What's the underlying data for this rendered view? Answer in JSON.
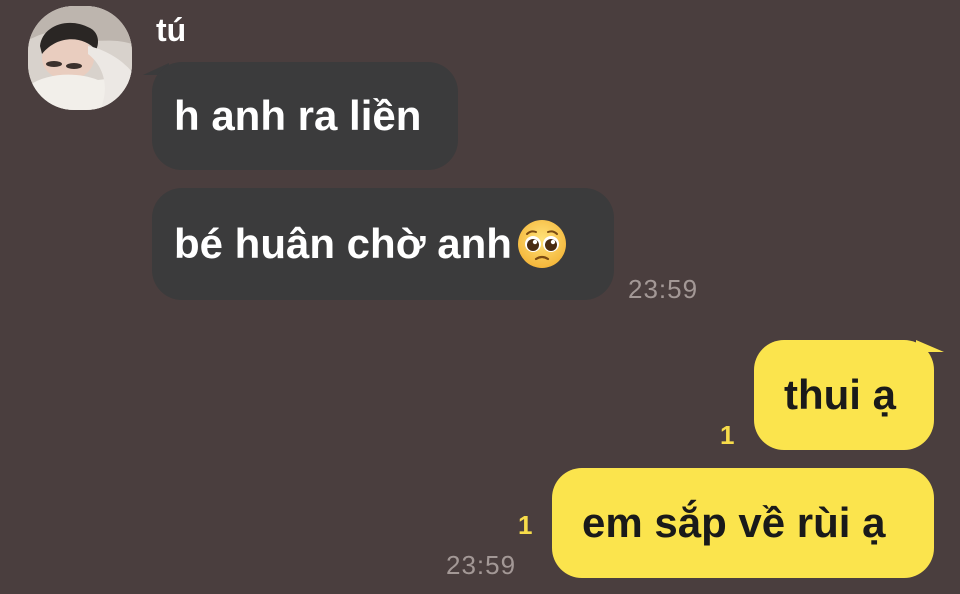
{
  "sender": {
    "name": "tú",
    "avatar_icon": "profile-photo-icon"
  },
  "messages": [
    {
      "direction": "incoming",
      "text": "h anh ra liền",
      "time": "",
      "unread": ""
    },
    {
      "direction": "incoming",
      "text": "bé huân chờ anh",
      "emoji": "pleading-face-emoji-icon",
      "time": "23:59",
      "unread": ""
    },
    {
      "direction": "outgoing",
      "text": "thui ạ",
      "time": "",
      "unread": "1"
    },
    {
      "direction": "outgoing",
      "text": "em sắp về rùi ạ",
      "time": "23:59",
      "unread": "1"
    }
  ],
  "colors": {
    "background": "#4a3e3e",
    "incoming_bubble": "#3b3b3c",
    "outgoing_bubble": "#fbe44d",
    "unread_count": "#f7dc4a",
    "timestamp": "#a39896"
  }
}
